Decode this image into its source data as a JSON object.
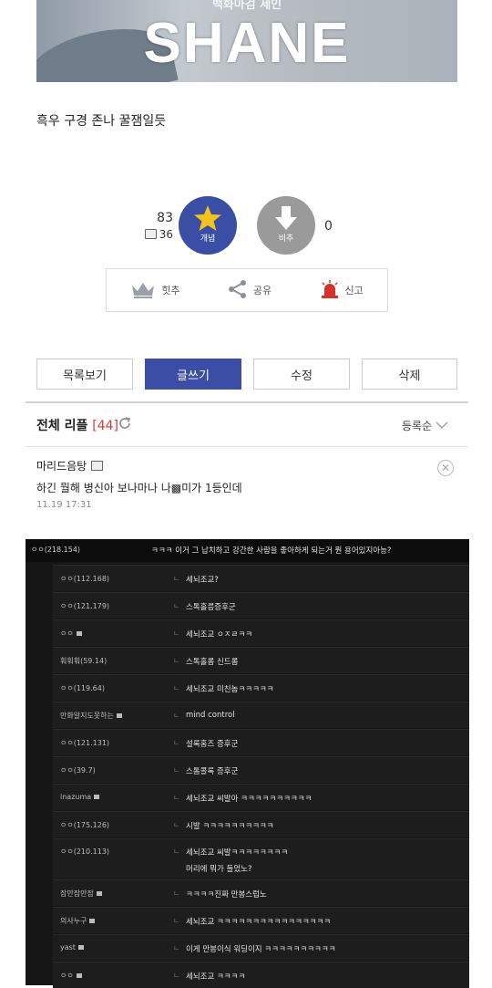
{
  "banner": {
    "subtitle": "백화마검 세인",
    "title": "SHANE"
  },
  "post": {
    "text": "흑우 구경 존나 꿀잼일듯"
  },
  "vote": {
    "up_count": "83",
    "up_sub_count": "36",
    "up_label": "개념",
    "down_label": "비추",
    "down_count": "0"
  },
  "actions": {
    "recommend": "힛추",
    "share": "공유",
    "report": "신고"
  },
  "buttons": {
    "list": "목록보기",
    "write": "글쓰기",
    "edit": "수정",
    "delete": "삭제"
  },
  "replies": {
    "title": "전체 리플",
    "count": "[44]",
    "sort": "등록순"
  },
  "comment": {
    "author": "마리드음탕",
    "text": "하긴 뭘해 병신아 보나마나 나▩미가 1등인데",
    "time": "11.19 17:31"
  },
  "dark_comments": {
    "top_author": "ㅇㅇ(218.154)",
    "top_text": "ㅋㅋㅋ 이거 그 납치하고 강간한 사람을 좋아하게 되는거 뭔 용어있지아능?",
    "rows": [
      {
        "author": "ㅇㅇ(112.168)",
        "text": "세뇌조교?"
      },
      {
        "author": "ㅇㅇ(121.179)",
        "text": "스톡홀름증후군"
      },
      {
        "author": "ㅇㅇ",
        "text": "세뇌조교 ㅇㅈㄹㅋㅋ"
      },
      {
        "author": "훠훠훠(59.14)",
        "text": "스톡홀롬 신드롬"
      },
      {
        "author": "ㅇㅇ(119.64)",
        "text": "세뇌조교 미친놈ㅋㅋㅋㅋㅋ"
      },
      {
        "author": "만화알지도못하는",
        "text": "mind control"
      },
      {
        "author": "ㅇㅇ(121.131)",
        "text": "설록홈즈 증후군"
      },
      {
        "author": "ㅇㅇ(39.7)",
        "text": "스톰콜록 증후군"
      },
      {
        "author": "inazuma",
        "text": "세뇌조교 씨발아 ㅋㅋㅋㅋㅋㅋㅋㅋㅋㅋ"
      },
      {
        "author": "ㅇㅇ(175.126)",
        "text": "시발 ㅋㅋㅋㅋㅋㅋㅋㅋㅋㅋ"
      },
      {
        "author": "ㅇㅇ(210.113)",
        "text": "세뇌조교 씨발ㅋㅋㅋㅋㅋㅋㅋㅋ",
        "text2": "머리에 뭐가 들었노?"
      },
      {
        "author": "잠만잠만잠",
        "text": "ㅋㅋㅋㅋ진짜 만봉스럽노"
      },
      {
        "author": "의사누구",
        "text": "세뇌조교 ㅋㅋㅋㅋㅋㅋㅋㅋㅋㅋㅋㅋㅋㅋㅋㅋ"
      },
      {
        "author": "yast",
        "text": "이게 만봉이식 워딩이지 ㅋㅋㅋㅋㅋㅋㅋㅋㅋㅋ"
      },
      {
        "author": "ㅇㅇ",
        "text": "세뇌조교 ㅋㅋㅋㅋ"
      }
    ]
  },
  "colors": {
    "primary": "#3b4da5",
    "accent_red": "#d23b3b",
    "downvote": "#9a9a9a",
    "dark_bg": "#161616"
  },
  "icons": [
    "star-icon",
    "down-arrow-icon",
    "crown-icon",
    "share-icon",
    "siren-icon",
    "refresh-icon",
    "chevron-down-icon",
    "close-icon",
    "comment-icon"
  ]
}
